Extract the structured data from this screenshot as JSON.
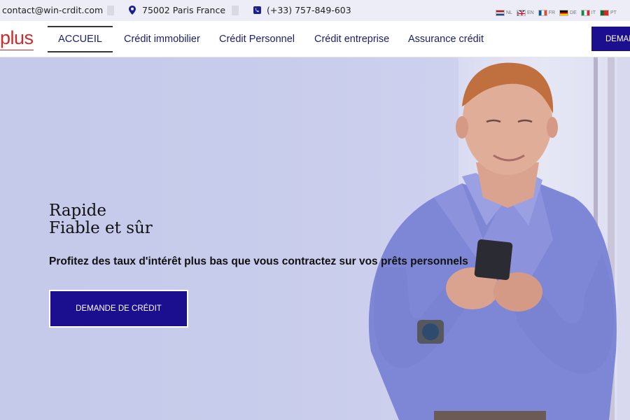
{
  "topbar": {
    "email": "contact@win-crdit.com",
    "address": "75002 Paris France",
    "phone": "(+33) 757-849-603",
    "languages": [
      {
        "code": "NL",
        "icon": "flag-nl-icon"
      },
      {
        "code": "EN",
        "icon": "flag-uk-icon"
      },
      {
        "code": "FR",
        "icon": "flag-fr-icon"
      },
      {
        "code": "DE",
        "icon": "flag-de-icon"
      },
      {
        "code": "IT",
        "icon": "flag-it-icon"
      },
      {
        "code": "PT",
        "icon": "flag-pt-icon"
      }
    ]
  },
  "nav": {
    "logo": "plus",
    "items": [
      {
        "label": "ACCUEIL",
        "active": true
      },
      {
        "label": "Crédit immobilier"
      },
      {
        "label": "Crédit Personnel"
      },
      {
        "label": "Crédit entreprise"
      },
      {
        "label": "Assurance crédit"
      }
    ],
    "cta": "DEMANDE DE CRÉDIT"
  },
  "hero": {
    "title_line1": "Rapide",
    "title_line2": "Fiable et sûr",
    "tagline": "Profitez des taux d'intérêt plus bas que vous contractez sur vos prêts personnels",
    "cta": "DEMANDE DE CRÉDIT"
  },
  "colors": {
    "accent": "#1b0e8f",
    "logo": "#cc2b2b",
    "nav_text": "#1a1f6b"
  }
}
